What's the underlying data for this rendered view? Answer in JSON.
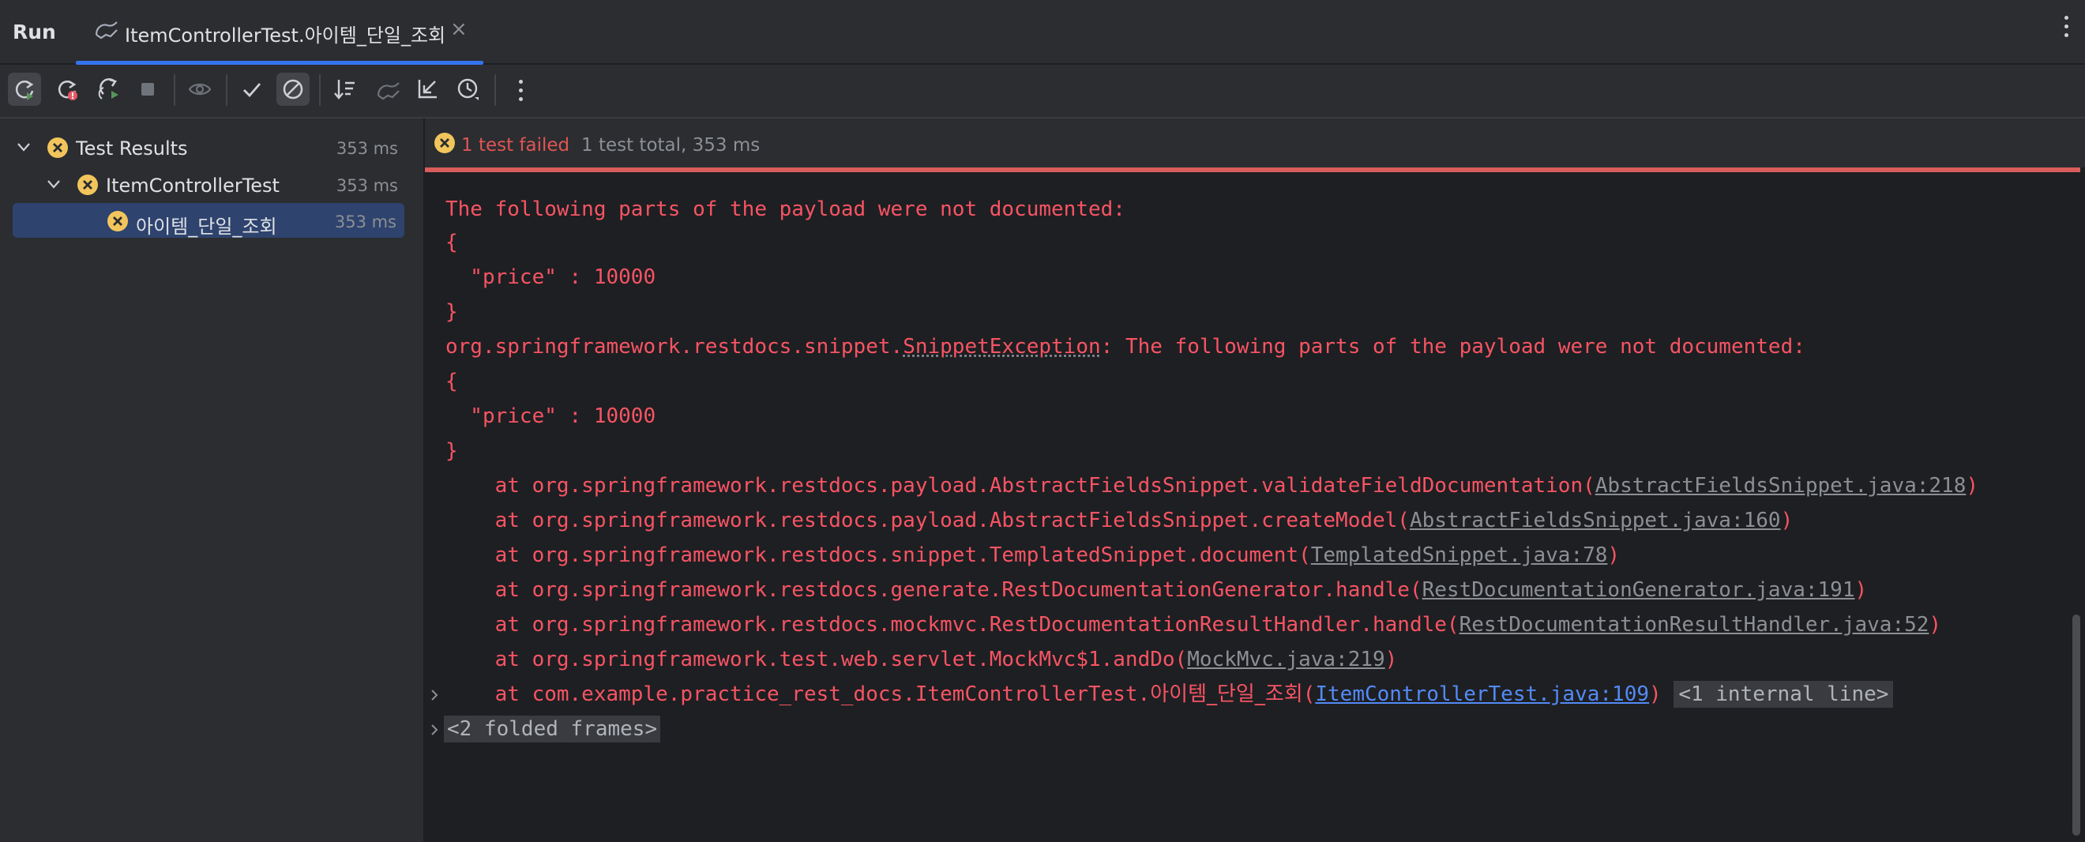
{
  "topbar": {
    "run_label": "Run",
    "tab_title": "ItemControllerTest.아이템_단일_조회",
    "tab_close": "×"
  },
  "toolbar": {
    "buttons": [
      {
        "name": "rerun-icon"
      },
      {
        "name": "rerun-failed-icon"
      },
      {
        "name": "toggle-auto-test-icon"
      },
      {
        "name": "stop-icon"
      },
      {
        "name": "show-ignored-icon"
      },
      {
        "name": "show-passed-icon"
      },
      {
        "name": "show-ignored-toggle-icon"
      },
      {
        "name": "sort-icon"
      },
      {
        "name": "history-test-icon"
      },
      {
        "name": "collapse-icon"
      },
      {
        "name": "test-history-icon"
      },
      {
        "name": "more-icon"
      }
    ]
  },
  "tree": {
    "nodes": [
      {
        "label": "Test Results",
        "duration": "353 ms"
      },
      {
        "label": "ItemControllerTest",
        "duration": "353 ms"
      },
      {
        "label": "아이템_단일_조회",
        "duration": "353 ms"
      }
    ]
  },
  "status": {
    "failed": "1 test failed",
    "total": "1 test total, 353 ms"
  },
  "log": {
    "l1": "The following parts of the payload were not documented:",
    "l2": "{",
    "l3": "  \"price\" : 10000",
    "l4": "}",
    "l5_pre": "org.springframework.restdocs.snippet.",
    "l5_exc": "SnippetException",
    "l5_post": ": The following parts of the payload were not documented:",
    "l6": "{",
    "l7": "  \"price\" : 10000",
    "l8": "}",
    "frames": [
      {
        "text": "    at org.springframework.restdocs.payload.AbstractFieldsSnippet.validateFieldDocumentation(",
        "link": "AbstractFieldsSnippet.java:218",
        "end": ")"
      },
      {
        "text": "    at org.springframework.restdocs.payload.AbstractFieldsSnippet.createModel(",
        "link": "AbstractFieldsSnippet.java:160",
        "end": ")"
      },
      {
        "text": "    at org.springframework.restdocs.snippet.TemplatedSnippet.document(",
        "link": "TemplatedSnippet.java:78",
        "end": ")"
      },
      {
        "text": "    at org.springframework.restdocs.generate.RestDocumentationGenerator.handle(",
        "link": "RestDocumentationGenerator.java:191",
        "end": ")"
      },
      {
        "text": "    at org.springframework.restdocs.mockmvc.RestDocumentationResultHandler.handle(",
        "link": "RestDocumentationResultHandler.java:52",
        "end": ")"
      },
      {
        "text": "    at org.springframework.test.web.servlet.MockMvc$1.andDo(",
        "link": "MockMvc.java:219",
        "end": ")"
      }
    ],
    "last_frame_pre": "    at com.example.practice_rest_docs.ItemControllerTest.",
    "last_frame_method": "아이템_단일_조회",
    "last_frame_paren": "(",
    "last_frame_link": "ItemControllerTest.java:109",
    "last_frame_end": ")",
    "internal_line": "<1 internal line>",
    "folded_frames": "<2 folded frames>"
  }
}
